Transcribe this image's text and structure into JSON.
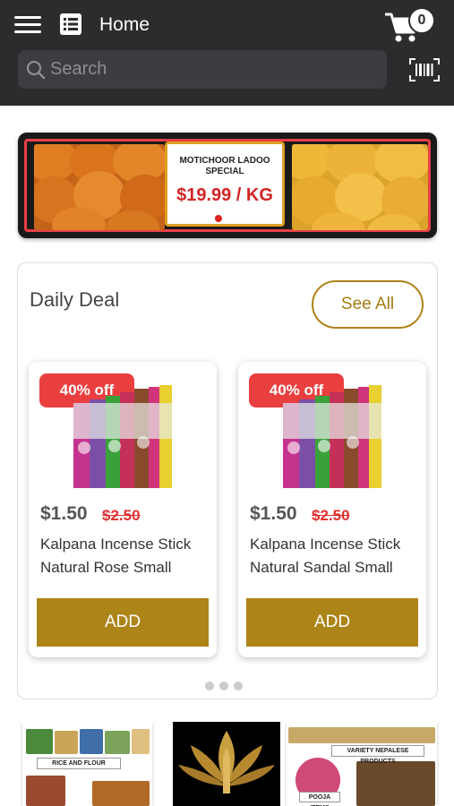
{
  "header": {
    "title": "Home",
    "cart_count": "0",
    "menu_icon": "hamburger-menu-icon",
    "list_icon": "list-icon",
    "cart_icon": "cart-icon",
    "barcode_icon": "barcode-scan-icon"
  },
  "search": {
    "placeholder": "Search",
    "value": ""
  },
  "banner": {
    "subtitle": "MOTICHOOR LADOO SPECIAL",
    "price": "$19.99 / KG"
  },
  "deal": {
    "title": "Daily Deal",
    "see_all": "See All",
    "products": [
      {
        "badge": "40% off",
        "price": "$1.50",
        "old_price": "$2.50",
        "name": "Kalpana Incense Stick Natural Rose Small",
        "add_label": "ADD"
      },
      {
        "badge": "40% off",
        "price": "$1.50",
        "old_price": "$2.50",
        "name": "Kalpana Incense Stick Natural Sandal Small",
        "add_label": "ADD"
      }
    ]
  },
  "categories": [
    {
      "label": "RICE AND FLOUR"
    },
    {
      "label": ""
    },
    {
      "label": "VARIETY NEPALESE PRODUCTS",
      "sub": "POOJA ITEMS"
    }
  ],
  "colors": {
    "header_bg": "#2b2c2e",
    "accent_gold": "#ad8418",
    "discount_red": "#ea3f3f"
  }
}
